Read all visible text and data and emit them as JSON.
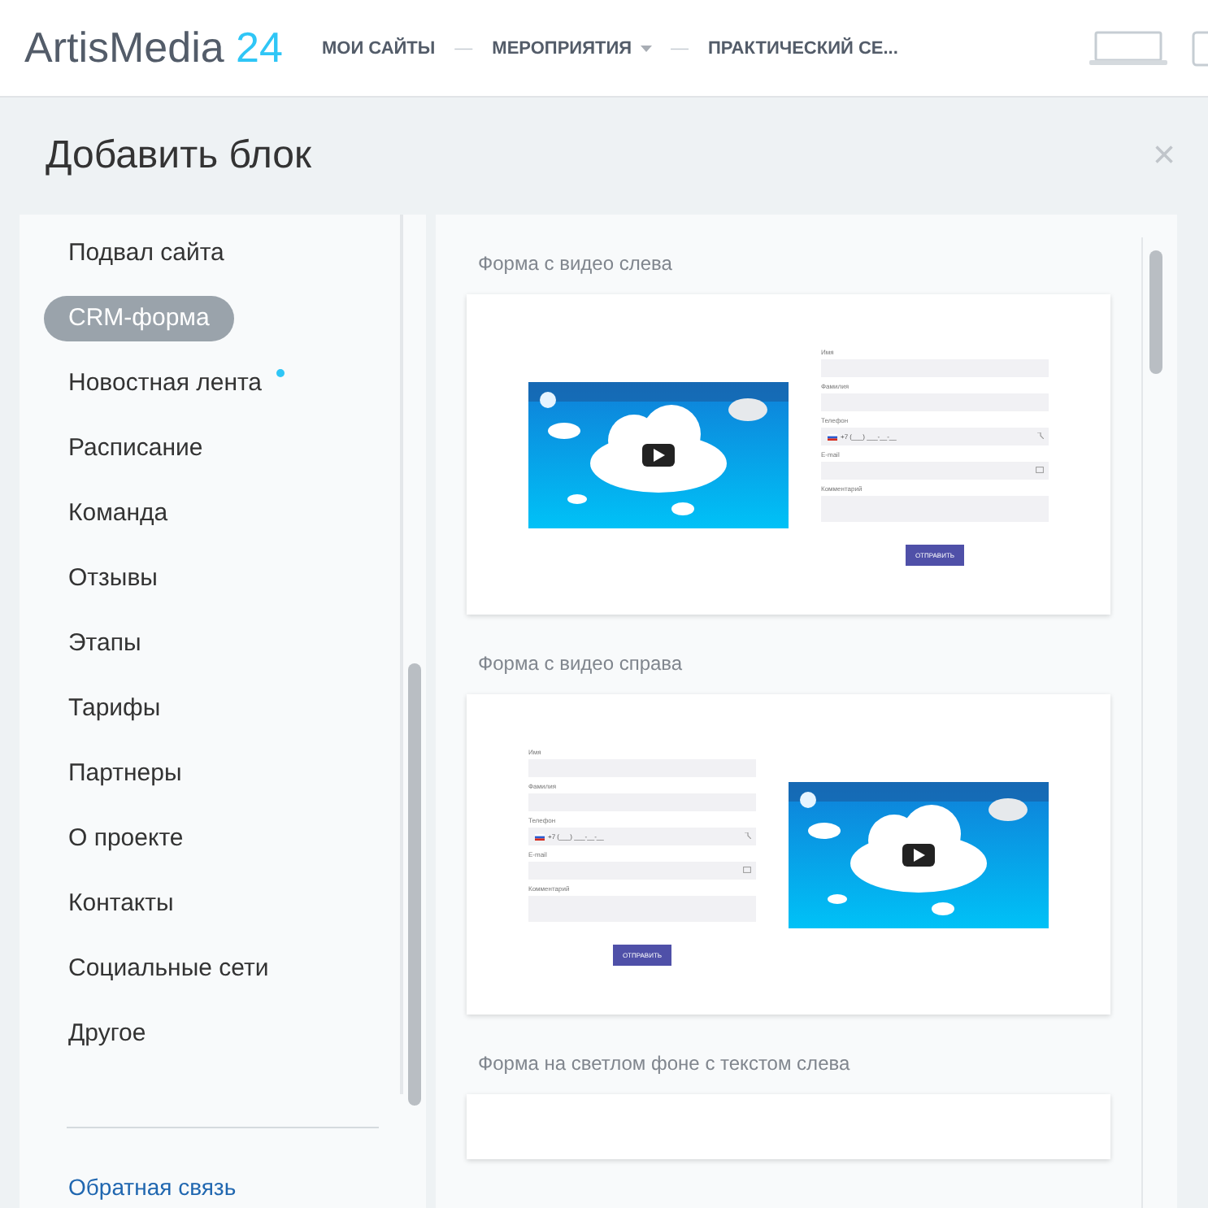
{
  "header": {
    "logo": {
      "name": "ArtisMedia",
      "number": "24"
    },
    "nav": [
      {
        "label": "МОИ САЙТЫ",
        "dropdown": false
      },
      {
        "label": "МЕРОПРИЯТИЯ",
        "dropdown": true
      },
      {
        "label": "ПРАКТИЧЕСКИЙ СЕ..."
      }
    ],
    "separator": "—"
  },
  "dialog": {
    "title": "Добавить блок",
    "close": "×"
  },
  "sidebar": {
    "items": [
      {
        "label": "Подвал сайта",
        "selected": false,
        "new": false
      },
      {
        "label": "CRM-форма",
        "selected": true,
        "new": false
      },
      {
        "label": "Новостная лента",
        "selected": false,
        "new": true
      },
      {
        "label": "Расписание",
        "selected": false,
        "new": false
      },
      {
        "label": "Команда",
        "selected": false,
        "new": false
      },
      {
        "label": "Отзывы",
        "selected": false,
        "new": false
      },
      {
        "label": "Этапы",
        "selected": false,
        "new": false
      },
      {
        "label": "Тарифы",
        "selected": false,
        "new": false
      },
      {
        "label": "Партнеры",
        "selected": false,
        "new": false
      },
      {
        "label": "О проекте",
        "selected": false,
        "new": false
      },
      {
        "label": "Контакты",
        "selected": false,
        "new": false
      },
      {
        "label": "Социальные сети",
        "selected": false,
        "new": false
      },
      {
        "label": "Другое",
        "selected": false,
        "new": false
      }
    ],
    "feedback": "Обратная связь"
  },
  "blocks": [
    {
      "title": "Форма с видео слева",
      "kind": "video-left",
      "form": {
        "fields": [
          {
            "label": "Имя",
            "kind": "text"
          },
          {
            "label": "Фамилия",
            "kind": "text"
          },
          {
            "label": "Телефон",
            "kind": "phone",
            "value": "+7 (___) ___-__-__"
          },
          {
            "label": "E-mail",
            "kind": "email"
          },
          {
            "label": "Комментарий",
            "kind": "textarea"
          }
        ],
        "submit": "ОТПРАВИТЬ"
      }
    },
    {
      "title": "Форма с видео справа",
      "kind": "video-right",
      "form": {
        "fields": [
          {
            "label": "Имя",
            "kind": "text"
          },
          {
            "label": "Фамилия",
            "kind": "text"
          },
          {
            "label": "Телефон",
            "kind": "phone",
            "value": "+7 (___) ___-__-__"
          },
          {
            "label": "E-mail",
            "kind": "email"
          },
          {
            "label": "Комментарий",
            "kind": "textarea"
          }
        ],
        "submit": "ОТПРАВИТЬ"
      }
    },
    {
      "title": "Форма на светлом фоне с текстом слева",
      "kind": "plain"
    }
  ]
}
